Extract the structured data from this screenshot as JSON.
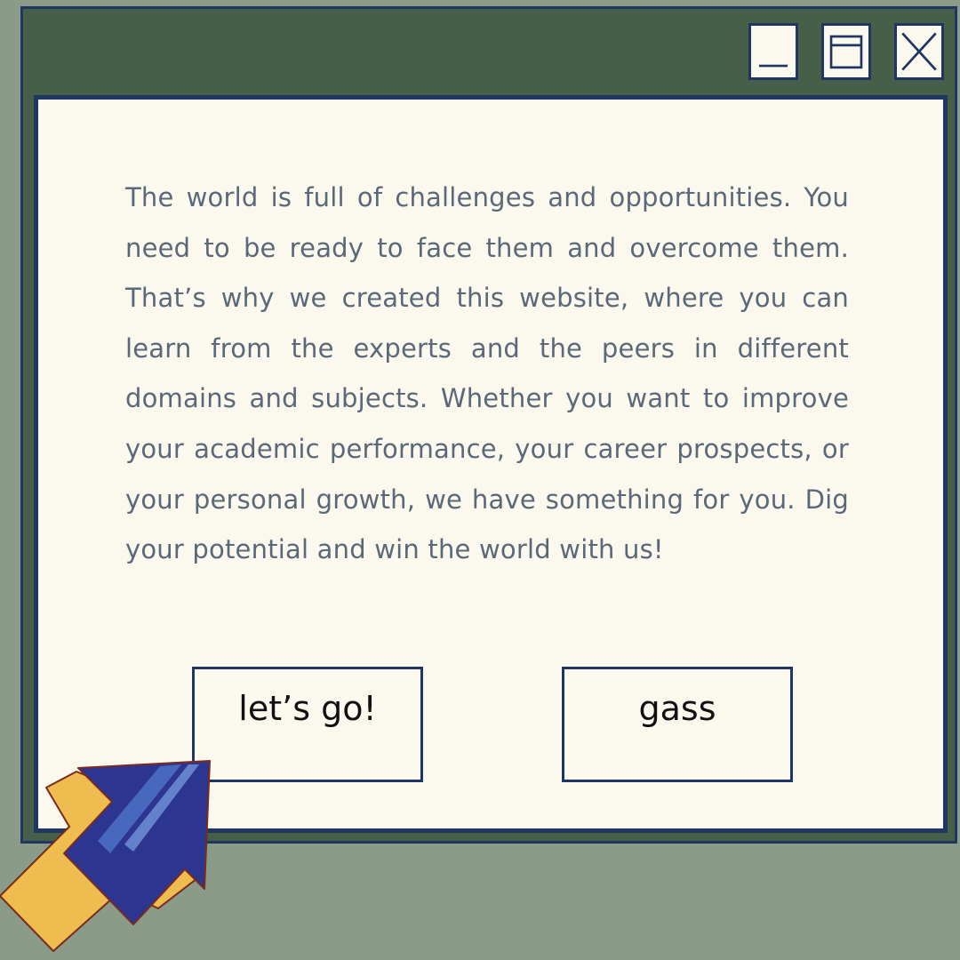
{
  "window": {
    "controls": {
      "minimize_icon": "minimize-icon",
      "maximize_icon": "maximize-icon",
      "close_icon": "close-icon"
    },
    "body_text": "The world is full of challenges and opportunities. You need to be ready to face them and overcome them. That’s why we created this website, where you can learn from the experts and the peers in different domains and subjects. Whether you want to improve your academic performance, your career prospects, or your personal growth, we have something for you. Dig your potential and win the world with us!",
    "buttons": {
      "primary_label": "let’s go!",
      "secondary_label": "gass"
    }
  },
  "colors": {
    "desktop": "#8a9c88",
    "title_bar": "#465f48",
    "border": "#1f3662",
    "panel": "#fbf8ee",
    "text": "#5a6878",
    "cursor_fill": "#2c3590",
    "cursor_shadow": "#eebc4f"
  },
  "cursor": {
    "icon": "arrow-cursor-icon"
  }
}
